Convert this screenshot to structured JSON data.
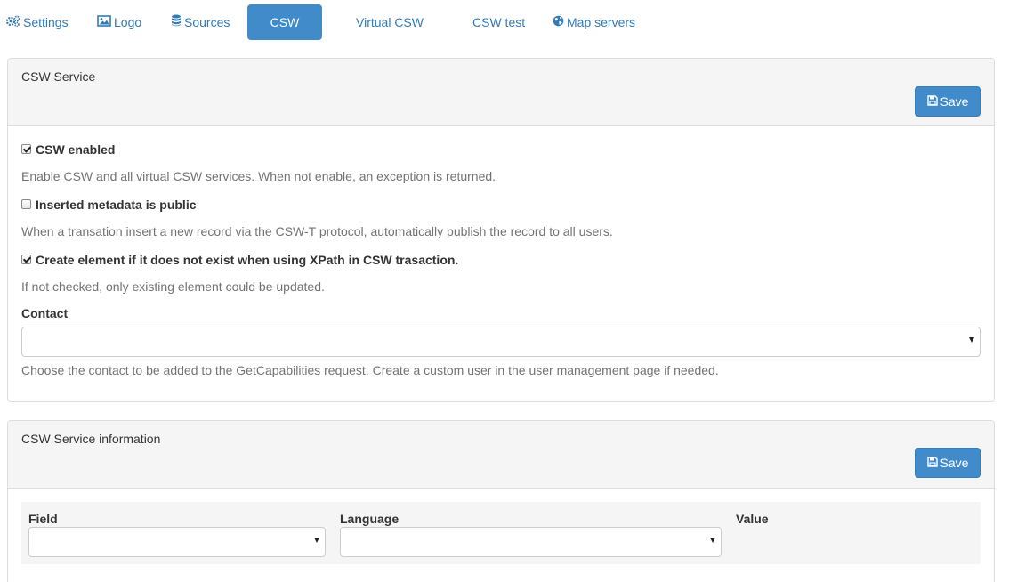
{
  "tabs": [
    {
      "label": "Settings",
      "icon": "gears-icon"
    },
    {
      "label": "Logo",
      "icon": "image-icon"
    },
    {
      "label": "Sources",
      "icon": "database-icon"
    },
    {
      "label": "CSW",
      "active": true
    },
    {
      "label": "Virtual CSW"
    },
    {
      "label": "CSW test"
    },
    {
      "label": "Map servers",
      "icon": "globe-icon"
    }
  ],
  "csw_service": {
    "title": "CSW Service",
    "save_label": "Save",
    "options": [
      {
        "label": "CSW enabled",
        "checked": true,
        "help": "Enable CSW and all virtual CSW services. When not enable, an exception is returned."
      },
      {
        "label": "Inserted metadata is public",
        "checked": false,
        "help": "When a transation insert a new record via the CSW-T protocol, automatically publish the record to all users."
      },
      {
        "label": "Create element if it does not exist when using XPath in CSW trasaction.",
        "checked": true,
        "help": "If not checked, only existing element could be updated."
      }
    ],
    "contact": {
      "label": "Contact",
      "value": "",
      "help": "Choose the contact to be added to the GetCapabilities request. Create a custom user in the user management page if needed."
    }
  },
  "csw_info": {
    "title": "CSW Service information",
    "save_label": "Save",
    "columns": [
      "Field",
      "Language",
      "Value"
    ],
    "field_value": "",
    "language_value": ""
  },
  "colors": {
    "primary": "#428bca",
    "link": "#337ab7",
    "panel_heading_bg": "#f5f5f5",
    "help_text": "#737373"
  }
}
